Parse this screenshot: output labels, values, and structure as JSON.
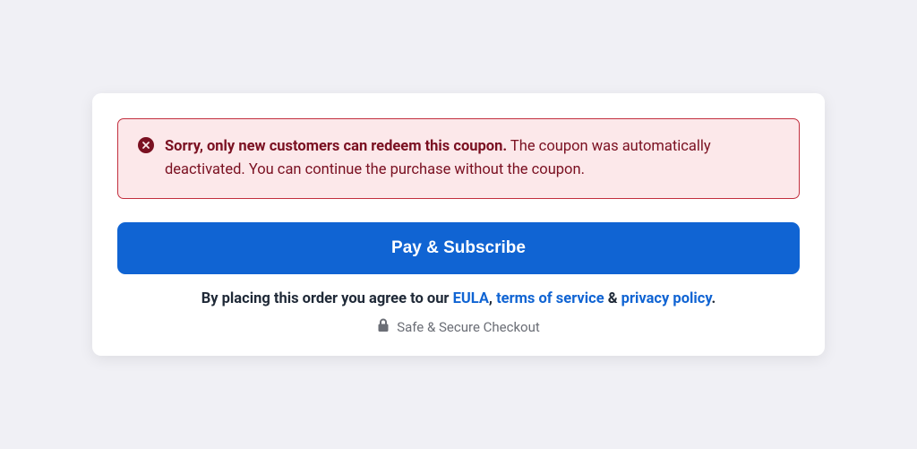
{
  "alert": {
    "bold": "Sorry, only new customers can redeem this coupon.",
    "rest": " The coupon was automatically deactivated. You can continue the purchase without the coupon."
  },
  "button": {
    "label": "Pay & Subscribe"
  },
  "legal": {
    "prefix": "By placing this order you agree to our ",
    "eula": "EULA",
    "comma": ", ",
    "tos": "terms of service",
    "amp": " & ",
    "privacy": "privacy policy",
    "period": "."
  },
  "secure": {
    "label": "Safe & Secure Checkout"
  }
}
